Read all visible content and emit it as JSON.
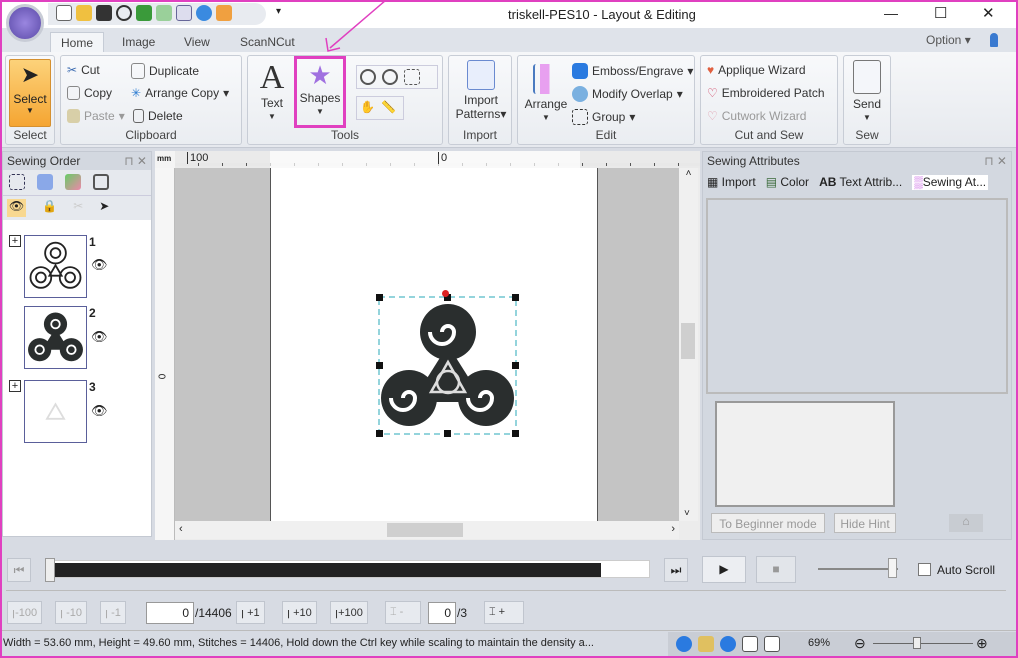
{
  "window": {
    "title": "triskell-PES10 - Layout & Editing",
    "minimize": "—",
    "maximize": "☐",
    "close": "✕"
  },
  "tabs": [
    {
      "label": "Home",
      "active": true
    },
    {
      "label": "Image"
    },
    {
      "label": "View"
    },
    {
      "label": "ScanNCut"
    }
  ],
  "option": {
    "label": "Option",
    "caret": "▾"
  },
  "ribbon": {
    "select": {
      "label": "Select",
      "group": "Select"
    },
    "clipboard": {
      "group": "Clipboard",
      "cut": "Cut",
      "copy": "Copy",
      "paste": "Paste",
      "duplicate": "Duplicate",
      "arrange_copy": "Arrange Copy",
      "delete": "Delete"
    },
    "tools": {
      "group": "Tools",
      "text": "Text",
      "shapes": "Shapes"
    },
    "import": {
      "group": "Import",
      "import_patterns_1": "Import",
      "import_patterns_2": "Patterns"
    },
    "edit": {
      "group": "Edit",
      "arrange": "Arrange",
      "emboss": "Emboss/Engrave",
      "modify_overlap": "Modify Overlap",
      "group_btn": "Group"
    },
    "cut_and_sew": {
      "group": "Cut and Sew",
      "applique": "Applique Wizard",
      "patch": "Embroidered Patch",
      "cutwork": "Cutwork Wizard"
    },
    "sew": {
      "group": "Sew",
      "send": "Send"
    }
  },
  "sewing_order": {
    "title": "Sewing Order",
    "items": [
      {
        "num": "1"
      },
      {
        "num": "2"
      },
      {
        "num": "3"
      }
    ]
  },
  "ruler": {
    "unit": "mm",
    "h_100": "100",
    "h_0": "0",
    "v_0": "0"
  },
  "sewing_attributes": {
    "title": "Sewing Attributes",
    "tabs": [
      "Import",
      "Color",
      "Text Attrib...",
      "Sewing At..."
    ],
    "beginner": "To Beginner mode",
    "hide_hint": "Hide Hint"
  },
  "playback": {
    "auto_scroll": "Auto Scroll",
    "progress_percent": 100
  },
  "stitch": {
    "minus100": "-100",
    "minus10": "-10",
    "minus1": "-1",
    "current": "0",
    "total": "/14406",
    "plus1": "+1",
    "plus10": "+10",
    "plus100": "+100",
    "color_minus": "-",
    "color_current": "0",
    "color_total": "/3",
    "color_plus": "+"
  },
  "status": {
    "text": "Width = 53.60 mm, Height = 49.60 mm, Stitches = 14406, Hold down the Ctrl key while scaling to maintain the density a...",
    "zoom": "69%"
  },
  "colors": {
    "annotation": "#e040c0",
    "select_orange": "#f5b544",
    "design": "#2a2e2e",
    "selection": "#2aa8b8"
  }
}
